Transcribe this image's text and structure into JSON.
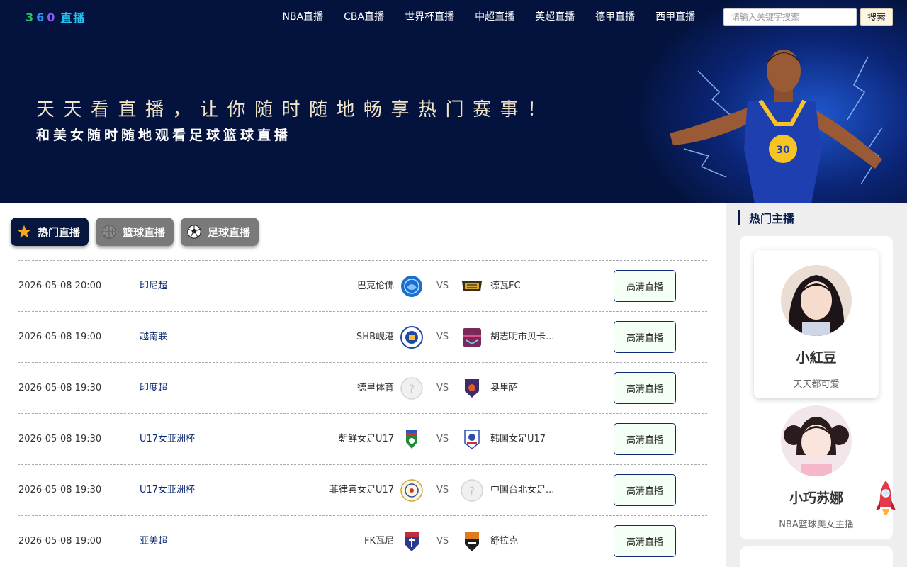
{
  "header": {
    "logo": {
      "d1": "3",
      "d2": "6",
      "d3": "0",
      "text": "直播"
    },
    "nav": [
      "NBA直播",
      "CBA直播",
      "世界杯直播",
      "中超直播",
      "英超直播",
      "德甲直播",
      "西甲直播"
    ],
    "search": {
      "placeholder": "请输入关键字搜索",
      "button": "搜索"
    }
  },
  "hero": {
    "slogan1": "天天看直播，让你随时随地畅享热门赛事！",
    "slogan2": "和美女随时随地观看足球篮球直播"
  },
  "tabs": [
    {
      "label": "热门直播",
      "icon": "star-icon",
      "active": true
    },
    {
      "label": "篮球直播",
      "icon": "basketball-icon",
      "active": false
    },
    {
      "label": "足球直播",
      "icon": "soccer-ball-icon",
      "active": false
    }
  ],
  "vs_label": "VS",
  "matches": [
    {
      "time": "2026-05-08 20:00",
      "league": "印尼超",
      "home": "巴克伦佛",
      "away": "德瓦FC",
      "button": "高清直播"
    },
    {
      "time": "2026-05-08 19:00",
      "league": "越南联",
      "home": "SHB岘港",
      "away": "胡志明市贝卡...",
      "button": "高清直播"
    },
    {
      "time": "2026-05-08 19:30",
      "league": "印度超",
      "home": "德里体育",
      "away": "奥里萨",
      "button": "高清直播"
    },
    {
      "time": "2026-05-08 19:30",
      "league": "U17女亚洲杯",
      "home": "朝鲜女足U17",
      "away": "韩国女足U17",
      "button": "高清直播"
    },
    {
      "time": "2026-05-08 19:30",
      "league": "U17女亚洲杯",
      "home": "菲律宾女足U17",
      "away": "中国台北女足...",
      "button": "高清直播"
    },
    {
      "time": "2026-05-08 19:00",
      "league": "亚美超",
      "home": "FK瓦尼",
      "away": "舒拉克",
      "button": "高清直播"
    }
  ],
  "sidebar": {
    "title": "热门主播",
    "streamers": [
      {
        "name": "小紅豆",
        "desc": "天天都可爱"
      },
      {
        "name": "小巧苏娜",
        "desc": "NBA篮球美女主播"
      }
    ]
  },
  "colors": {
    "header_bg": "#04133d",
    "accent": "#0d2a72",
    "button_bg": "#f4fff5",
    "tab_active": "#07173f",
    "tab_inactive": "#7a7a7a"
  }
}
